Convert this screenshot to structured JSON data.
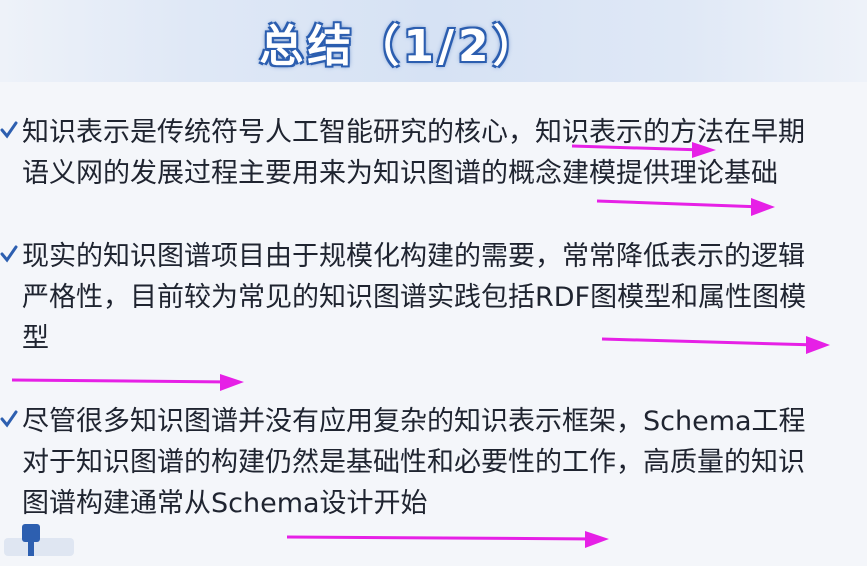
{
  "slide": {
    "title": "总结（1/2）"
  },
  "bullets": [
    {
      "text": "知识表示是传统符号人工智能研究的核心，知识表示的方法在早期语义网的发展过程主要用来为知识图谱的概念建模提供理论基础"
    },
    {
      "text": "现实的知识图谱项目由于规模化构建的需要，常常降低表示的逻辑严格性，目前较为常见的知识图谱实践包括RDF图模型和属性图模型"
    },
    {
      "text": "尽管很多知识图谱并没有应用复杂的知识表示框架，Schema工程对于知识图谱的构建仍然是基础性和必要性的工作，高质量的知识图谱构建通常从Schema设计开始"
    }
  ],
  "colors": {
    "title_outline": "#2d5fb0",
    "annotation": "#e620e6",
    "bullet_icon": "#2d5fb0"
  },
  "icons": {
    "bullet": "pen-check-icon"
  }
}
